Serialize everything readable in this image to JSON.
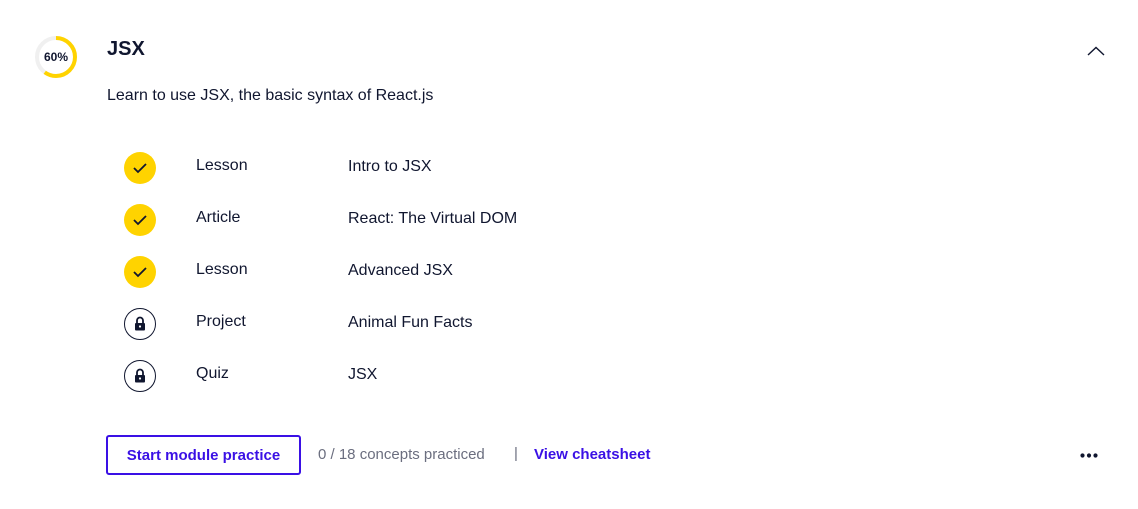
{
  "module": {
    "progress_label": "60%",
    "progress": 0.6,
    "title": "JSX",
    "description": "Learn to use JSX, the basic syntax of React.js",
    "expanded": true
  },
  "colors": {
    "accent": "#ffd300",
    "brand": "#3a10e5",
    "text": "#10162f",
    "muted": "#6b6e7f",
    "ring_track": "#f2f2f2"
  },
  "items": [
    {
      "type": "Lesson",
      "name": "Intro to JSX",
      "status": "completed",
      "icon": "checkmark-icon"
    },
    {
      "type": "Article",
      "name": "React: The Virtual DOM",
      "status": "completed",
      "icon": "checkmark-icon"
    },
    {
      "type": "Lesson",
      "name": "Advanced JSX",
      "status": "completed",
      "icon": "checkmark-icon"
    },
    {
      "type": "Project",
      "name": "Animal Fun Facts",
      "status": "locked",
      "icon": "lock-icon"
    },
    {
      "type": "Quiz",
      "name": "JSX",
      "status": "locked",
      "icon": "lock-icon"
    }
  ],
  "footer": {
    "practice_label": "Start module practice",
    "concepts_text": "0 / 18 concepts practiced",
    "separator": "|",
    "cheatsheet_label": "View cheatsheet"
  },
  "icons": {
    "collapse": "chevron-up-icon",
    "more": "more-options-icon"
  }
}
